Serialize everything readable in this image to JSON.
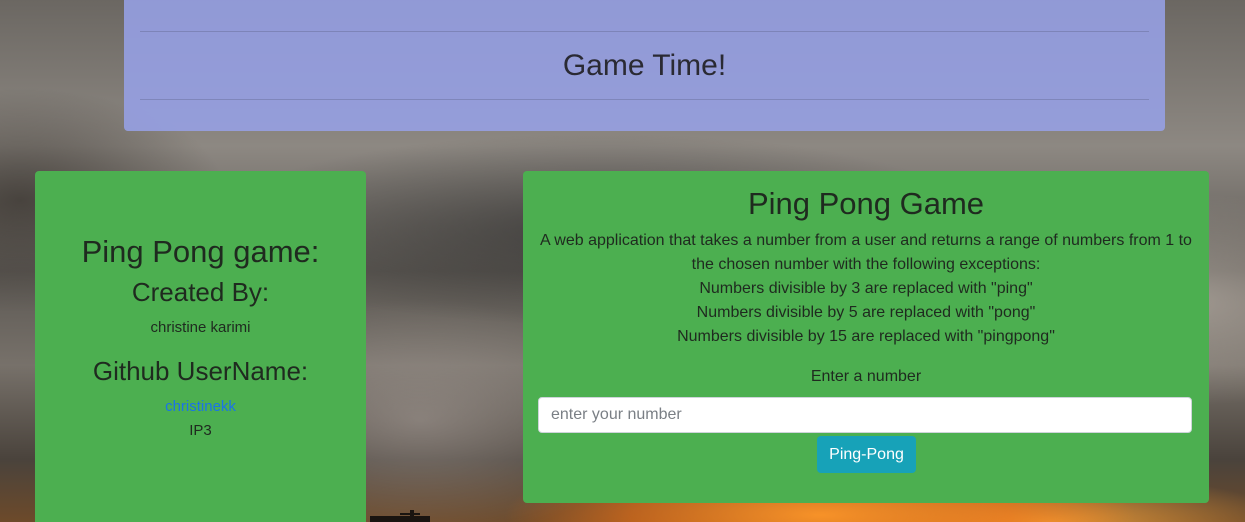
{
  "banner": {
    "title": "Game Time!"
  },
  "about_card": {
    "heading": "Ping Pong game:",
    "created_by_label": "Created By:",
    "author": "christine karimi",
    "github_label": "Github UserName:",
    "github_user": "christinekk",
    "project_code": "IP3"
  },
  "game_card": {
    "title": "Ping Pong Game",
    "description": [
      "A web application that takes a number from a user and returns a range of numbers from 1 to the chosen number with the following exceptions:",
      "Numbers divisible by 3 are replaced with \"ping\"",
      "Numbers divisible by 5 are replaced with \"pong\"",
      "Numbers divisible by 15 are replaced with \"pingpong\""
    ],
    "input_label": "Enter a number",
    "input_placeholder": "enter your number",
    "input_value": "",
    "button_label": "Ping-Pong"
  },
  "colors": {
    "banner_bg": "#96a0e6",
    "card_bg": "#4caf50",
    "button_bg": "#17a2b8",
    "link": "#1a73e8"
  }
}
